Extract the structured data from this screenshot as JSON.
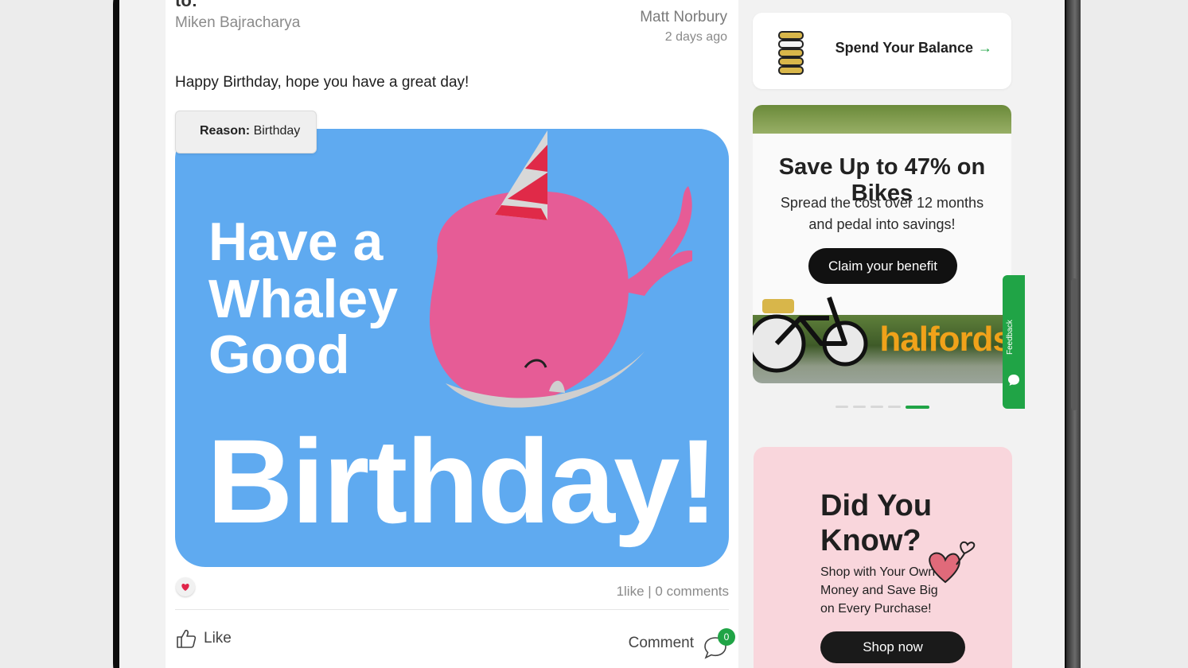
{
  "post": {
    "header_clip": "to:",
    "recipient": "Miken Bajracharya",
    "author": "Matt Norbury",
    "time": "2 days ago",
    "message": "Happy Birthday, hope you have a great day!",
    "reason_label": "Reason:",
    "reason_value": "Birthday",
    "card": {
      "line1": "Have a",
      "line2": "Whaley",
      "line3": "Good",
      "line4": "Birthday!",
      "background": "#5faaf0",
      "whale_color": "#e65c96"
    },
    "stats": "1like | 0 comments",
    "like_label": "Like",
    "comment_label": "Comment",
    "comment_count": "0"
  },
  "sidebar": {
    "balance": {
      "label": "Spend Your Balance",
      "arrow": "→",
      "icon": "coin-stack-icon"
    },
    "promo": {
      "title": "Save Up to 47% on Bikes",
      "subtitle_line1": "Spread the cost over 12 months",
      "subtitle_line2": "and pedal into savings!",
      "button": "Claim your benefit",
      "brand": "halfords",
      "dots_total": 5,
      "active_dot": 5
    },
    "feedback": {
      "label": "Feedback"
    },
    "did_you_know": {
      "title_line1": "Did You",
      "title_line2": "Know?",
      "text_line1": "Shop with Your Own",
      "text_line2": "Money and Save Big",
      "text_line3": "on Every Purchase!",
      "button": "Shop now",
      "background": "#f9d6dc"
    }
  },
  "colors": {
    "accent": "#20a446",
    "heart": "#e0254a"
  }
}
